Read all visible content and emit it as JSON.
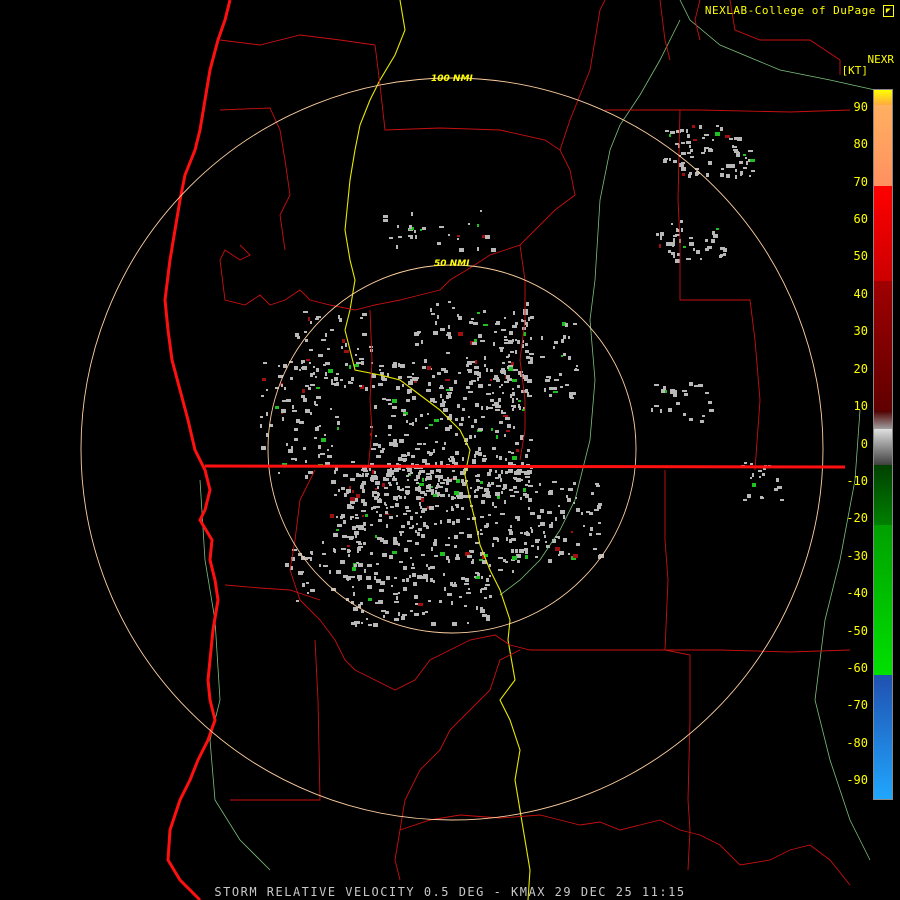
{
  "credit": "NEXLAB-College of DuPage",
  "logo": "college-of-dupage-logo",
  "product_short": "NEXR",
  "units": "[KT]",
  "footer": "STORM RELATIVE VELOCITY 0.5 DEG - KMAX 29 DEC 25 11:15",
  "range_rings": [
    "50 NMI",
    "100 NMI"
  ],
  "legend": {
    "ticks": [
      "90",
      "80",
      "70",
      "60",
      "50",
      "40",
      "30",
      "20",
      "10",
      "0",
      "-10",
      "-20",
      "-30",
      "-40",
      "-50",
      "-60",
      "-70",
      "-80",
      "-90"
    ],
    "range_kt": [
      -95,
      95
    ]
  },
  "colors": {
    "boundaries": "#ff1010",
    "coast": "#ff1010",
    "highway": "#e8e800",
    "river": "#7cc07c",
    "rings": "#ffd0a0",
    "text": "#ffff00"
  }
}
